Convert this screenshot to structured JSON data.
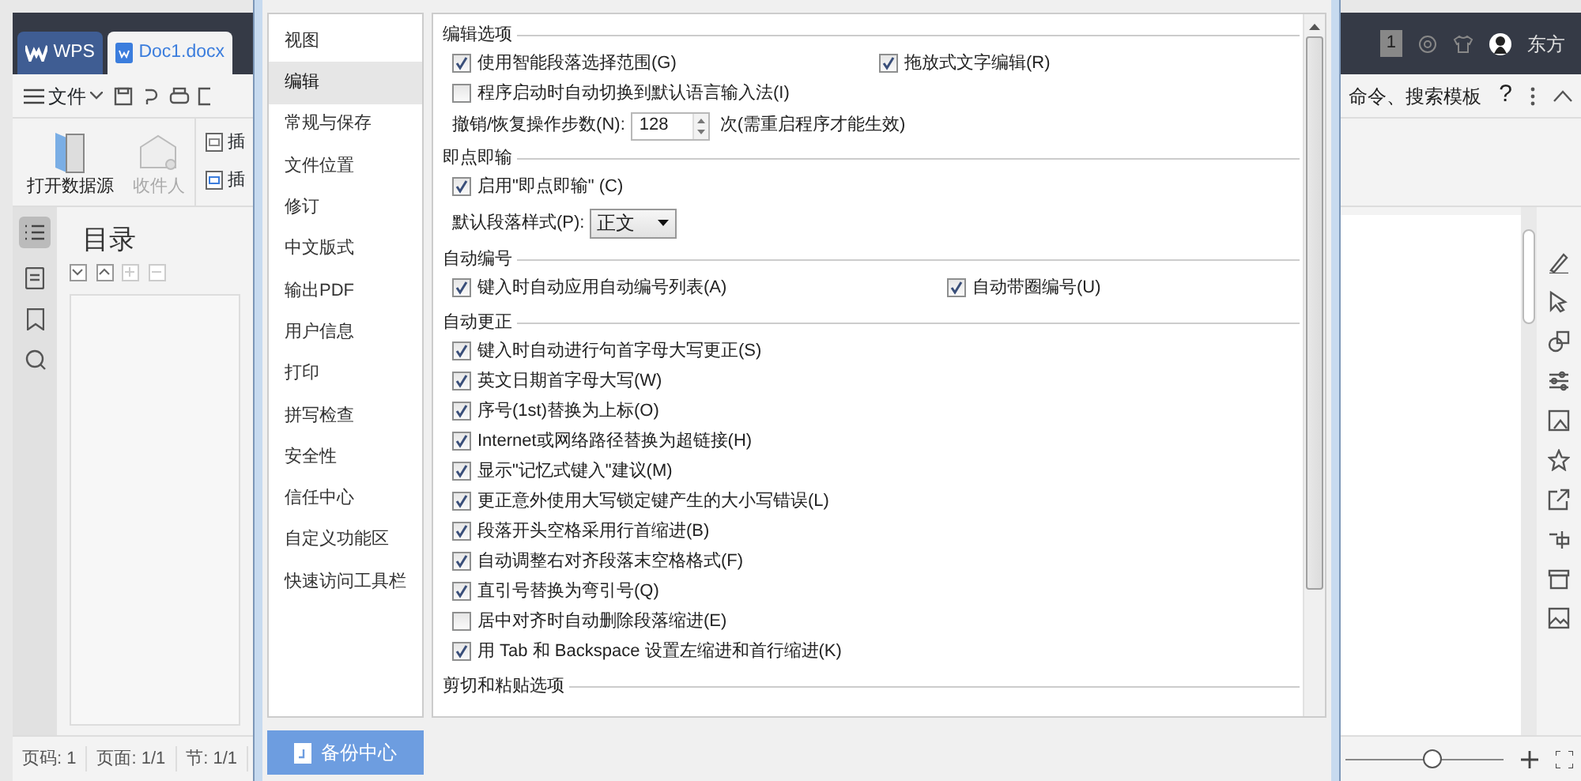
{
  "app": {
    "tabs": [
      {
        "label": "WPS",
        "selected": false
      },
      {
        "label": "Doc1.docx",
        "selected": true
      }
    ],
    "menu": "文件",
    "ribbon": [
      {
        "label": "打开数据源",
        "disabled": false
      },
      {
        "label": "收件人",
        "disabled": true
      }
    ],
    "ribbon_cut": [
      "插",
      "插"
    ],
    "badge": "1",
    "user": "东方",
    "search_hint": "命令、搜索模板",
    "help": "?",
    "toc_title": "目录",
    "status_bar": [
      "页码: 1",
      "页面: 1/1",
      "节: 1/1"
    ],
    "zoom": {
      "level": 0.55
    }
  },
  "dialog": {
    "nav": [
      {
        "label": "视图",
        "selected": false
      },
      {
        "label": "编辑",
        "selected": true
      },
      {
        "label": "常规与保存",
        "selected": false
      },
      {
        "label": "文件位置",
        "selected": false
      },
      {
        "label": "修订",
        "selected": false
      },
      {
        "label": "中文版式",
        "selected": false
      },
      {
        "label": "输出PDF",
        "selected": false
      },
      {
        "label": "用户信息",
        "selected": false
      },
      {
        "label": "打印",
        "selected": false
      },
      {
        "label": "拼写检查",
        "selected": false
      },
      {
        "label": "安全性",
        "selected": false
      },
      {
        "label": "信任中心",
        "selected": false
      },
      {
        "label": "自定义功能区",
        "selected": false
      },
      {
        "label": "快速访问工具栏",
        "selected": false
      }
    ],
    "sections": [
      {
        "title": "编辑选项",
        "rows": [
          {
            "kind": "checkboxes",
            "items": [
              {
                "label": "使用智能段落选择范围(G)",
                "checked": true
              },
              {
                "label": "拖放式文字编辑(R)",
                "checked": true
              }
            ]
          },
          {
            "kind": "checkboxes",
            "items": [
              {
                "label": "程序启动时自动切换到默认语言输入法(I)",
                "checked": false
              }
            ]
          },
          {
            "kind": "spinner",
            "label": "撤销/恢复操作步数(N):",
            "value": "128",
            "suffix": "次(需重启程序才能生效)"
          }
        ]
      },
      {
        "title": "即点即输",
        "rows": [
          {
            "kind": "checkboxes",
            "items": [
              {
                "label": "启用\"即点即输\" (C)",
                "checked": true
              }
            ]
          },
          {
            "kind": "select",
            "label": "默认段落样式(P):",
            "value": "正文"
          }
        ]
      },
      {
        "title": "自动编号",
        "rows": [
          {
            "kind": "checkboxes",
            "items": [
              {
                "label": "键入时自动应用自动编号列表(A)",
                "checked": true
              },
              {
                "label": "自动带圈编号(U)",
                "checked": true
              }
            ]
          }
        ]
      },
      {
        "title": "自动更正",
        "rows": [
          {
            "kind": "checkboxes",
            "items": [
              {
                "label": "键入时自动进行句首字母大写更正(S)",
                "checked": true
              }
            ]
          },
          {
            "kind": "checkboxes",
            "items": [
              {
                "label": "英文日期首字母大写(W)",
                "checked": true
              }
            ]
          },
          {
            "kind": "checkboxes",
            "items": [
              {
                "label": "序号(1st)替换为上标(O)",
                "checked": true
              }
            ]
          },
          {
            "kind": "checkboxes",
            "items": [
              {
                "label": "Internet或网络路径替换为超链接(H)",
                "checked": true
              }
            ]
          },
          {
            "kind": "checkboxes",
            "items": [
              {
                "label": "显示\"记忆式键入\"建议(M)",
                "checked": true
              }
            ]
          },
          {
            "kind": "checkboxes",
            "items": [
              {
                "label": "更正意外使用大写锁定键产生的大小写错误(L)",
                "checked": true
              }
            ]
          },
          {
            "kind": "checkboxes",
            "items": [
              {
                "label": "段落开头空格采用行首缩进(B)",
                "checked": true
              }
            ]
          },
          {
            "kind": "checkboxes",
            "items": [
              {
                "label": "自动调整右对齐段落末空格格式(F)",
                "checked": true
              }
            ]
          },
          {
            "kind": "checkboxes",
            "items": [
              {
                "label": "直引号替换为弯引号(Q)",
                "checked": true
              }
            ]
          },
          {
            "kind": "checkboxes",
            "items": [
              {
                "label": "居中对齐时自动删除段落缩进(E)",
                "checked": false
              }
            ]
          },
          {
            "kind": "checkboxes",
            "items": [
              {
                "label": "用 Tab 和 Backspace 设置左缩进和首行缩进(K)",
                "checked": true
              }
            ]
          }
        ]
      },
      {
        "title": "剪切和粘贴选项"
      }
    ],
    "backup_button": "备份中心"
  }
}
